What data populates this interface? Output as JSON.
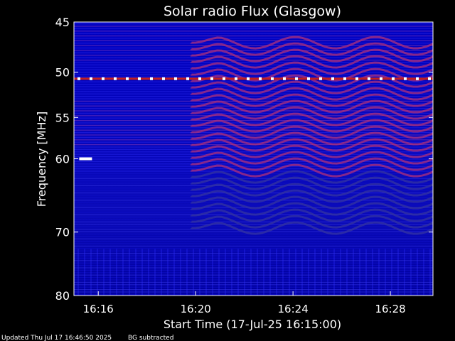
{
  "chart_data": {
    "type": "heatmap",
    "title": "Solar radio Flux (Glasgow)",
    "xlabel": "Start Time (17-Jul-25 16:15:00)",
    "ylabel": "Frequency [MHz]",
    "x_unit": "time",
    "x_range": [
      "16:15:00",
      "16:29:45"
    ],
    "x_ticks": [
      "16:16",
      "16:20",
      "16:24",
      "16:28"
    ],
    "y_unit": "MHz",
    "y_scale": "log-like",
    "y_range": [
      45,
      80
    ],
    "y_ticks": [
      45,
      50,
      55,
      60,
      70,
      80
    ],
    "colormap": [
      "#000030",
      "#0000c8",
      "#3a3aff",
      "#a02060",
      "#ff2a2a",
      "#ffffff"
    ],
    "features": [
      {
        "type": "persistent_band",
        "freq_mhz": 50.7,
        "intensity": "high"
      },
      {
        "type": "burst",
        "time": "16:15:20",
        "freq_mhz": 60.0,
        "intensity": "high"
      },
      {
        "type": "wave_pattern",
        "time_start": "16:21",
        "time_end": "16:29",
        "freq_range_mhz": [
          47,
          70
        ]
      }
    ]
  },
  "footer": {
    "updated": "Updated Thu Jul 17 16:46:50 2025",
    "note": "BG subtracted"
  }
}
